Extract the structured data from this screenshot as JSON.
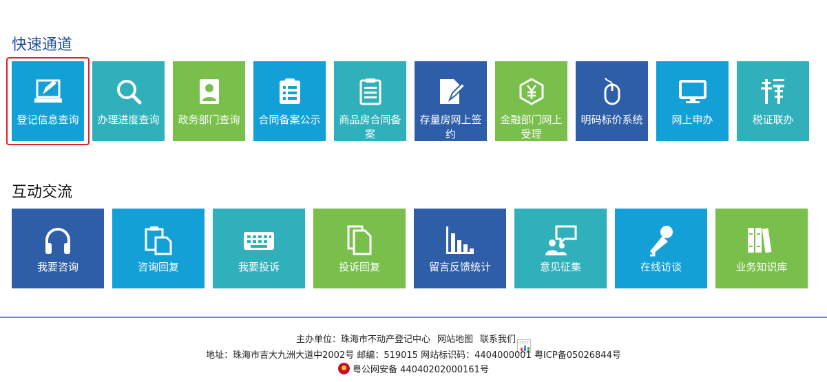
{
  "sections": {
    "quick": {
      "title": "快速通道",
      "items": [
        {
          "label": "登记信息查询",
          "icon": "edit-document-icon",
          "color": "#12a0d7"
        },
        {
          "label": "办理进度查询",
          "icon": "search-icon",
          "color": "#2fb0bb"
        },
        {
          "label": "政务部门查询",
          "icon": "id-card-icon",
          "color": "#78bf4b"
        },
        {
          "label": "合同备案公示",
          "icon": "list-document-icon",
          "color": "#12a0d7"
        },
        {
          "label": "商品房合同备案",
          "icon": "clipboard-icon",
          "color": "#2fb0bb"
        },
        {
          "label": "存量房网上签约",
          "icon": "sign-document-icon",
          "color": "#2e5ea8"
        },
        {
          "label": "金融部门网上受理",
          "icon": "yuan-hexagon-icon",
          "color": "#78bf4b"
        },
        {
          "label": "明码标价系统",
          "icon": "mouse-icon",
          "color": "#2e5ea8"
        },
        {
          "label": "网上申办",
          "icon": "monitor-icon",
          "color": "#12a0d7"
        },
        {
          "label": "税证联办",
          "icon": "tax-character-icon",
          "color": "#2fb0bb"
        }
      ]
    },
    "interact": {
      "title": "互动交流",
      "items": [
        {
          "label": "我要咨询",
          "icon": "headphones-icon",
          "color": "#2e5ea8"
        },
        {
          "label": "咨询回复",
          "icon": "copy-clipboard-icon",
          "color": "#12a0d7"
        },
        {
          "label": "我要投诉",
          "icon": "keyboard-icon",
          "color": "#2fb0bb"
        },
        {
          "label": "投诉回复",
          "icon": "documents-icon",
          "color": "#78bf4b"
        },
        {
          "label": "留言反馈统计",
          "icon": "bar-chart-icon",
          "color": "#2e5ea8"
        },
        {
          "label": "意见征集",
          "icon": "people-chat-icon",
          "color": "#2fb0bb"
        },
        {
          "label": "在线访谈",
          "icon": "microphone-icon",
          "color": "#12a0d7"
        },
        {
          "label": "业务知识库",
          "icon": "books-icon",
          "color": "#78bf4b"
        }
      ]
    }
  },
  "footer": {
    "host_prefix": "主办单位：",
    "host": "珠海市不动产登记中心",
    "sitemap": "网站地图",
    "contact": "联系我们",
    "stats_badge": "cnzz",
    "address_line": "地址：珠海市吉大九洲大道中2002号 邮编：519015 网站标识码：4404000001 粤ICP备05026844号",
    "police_record": "粤公网安备 44040202000161号"
  }
}
